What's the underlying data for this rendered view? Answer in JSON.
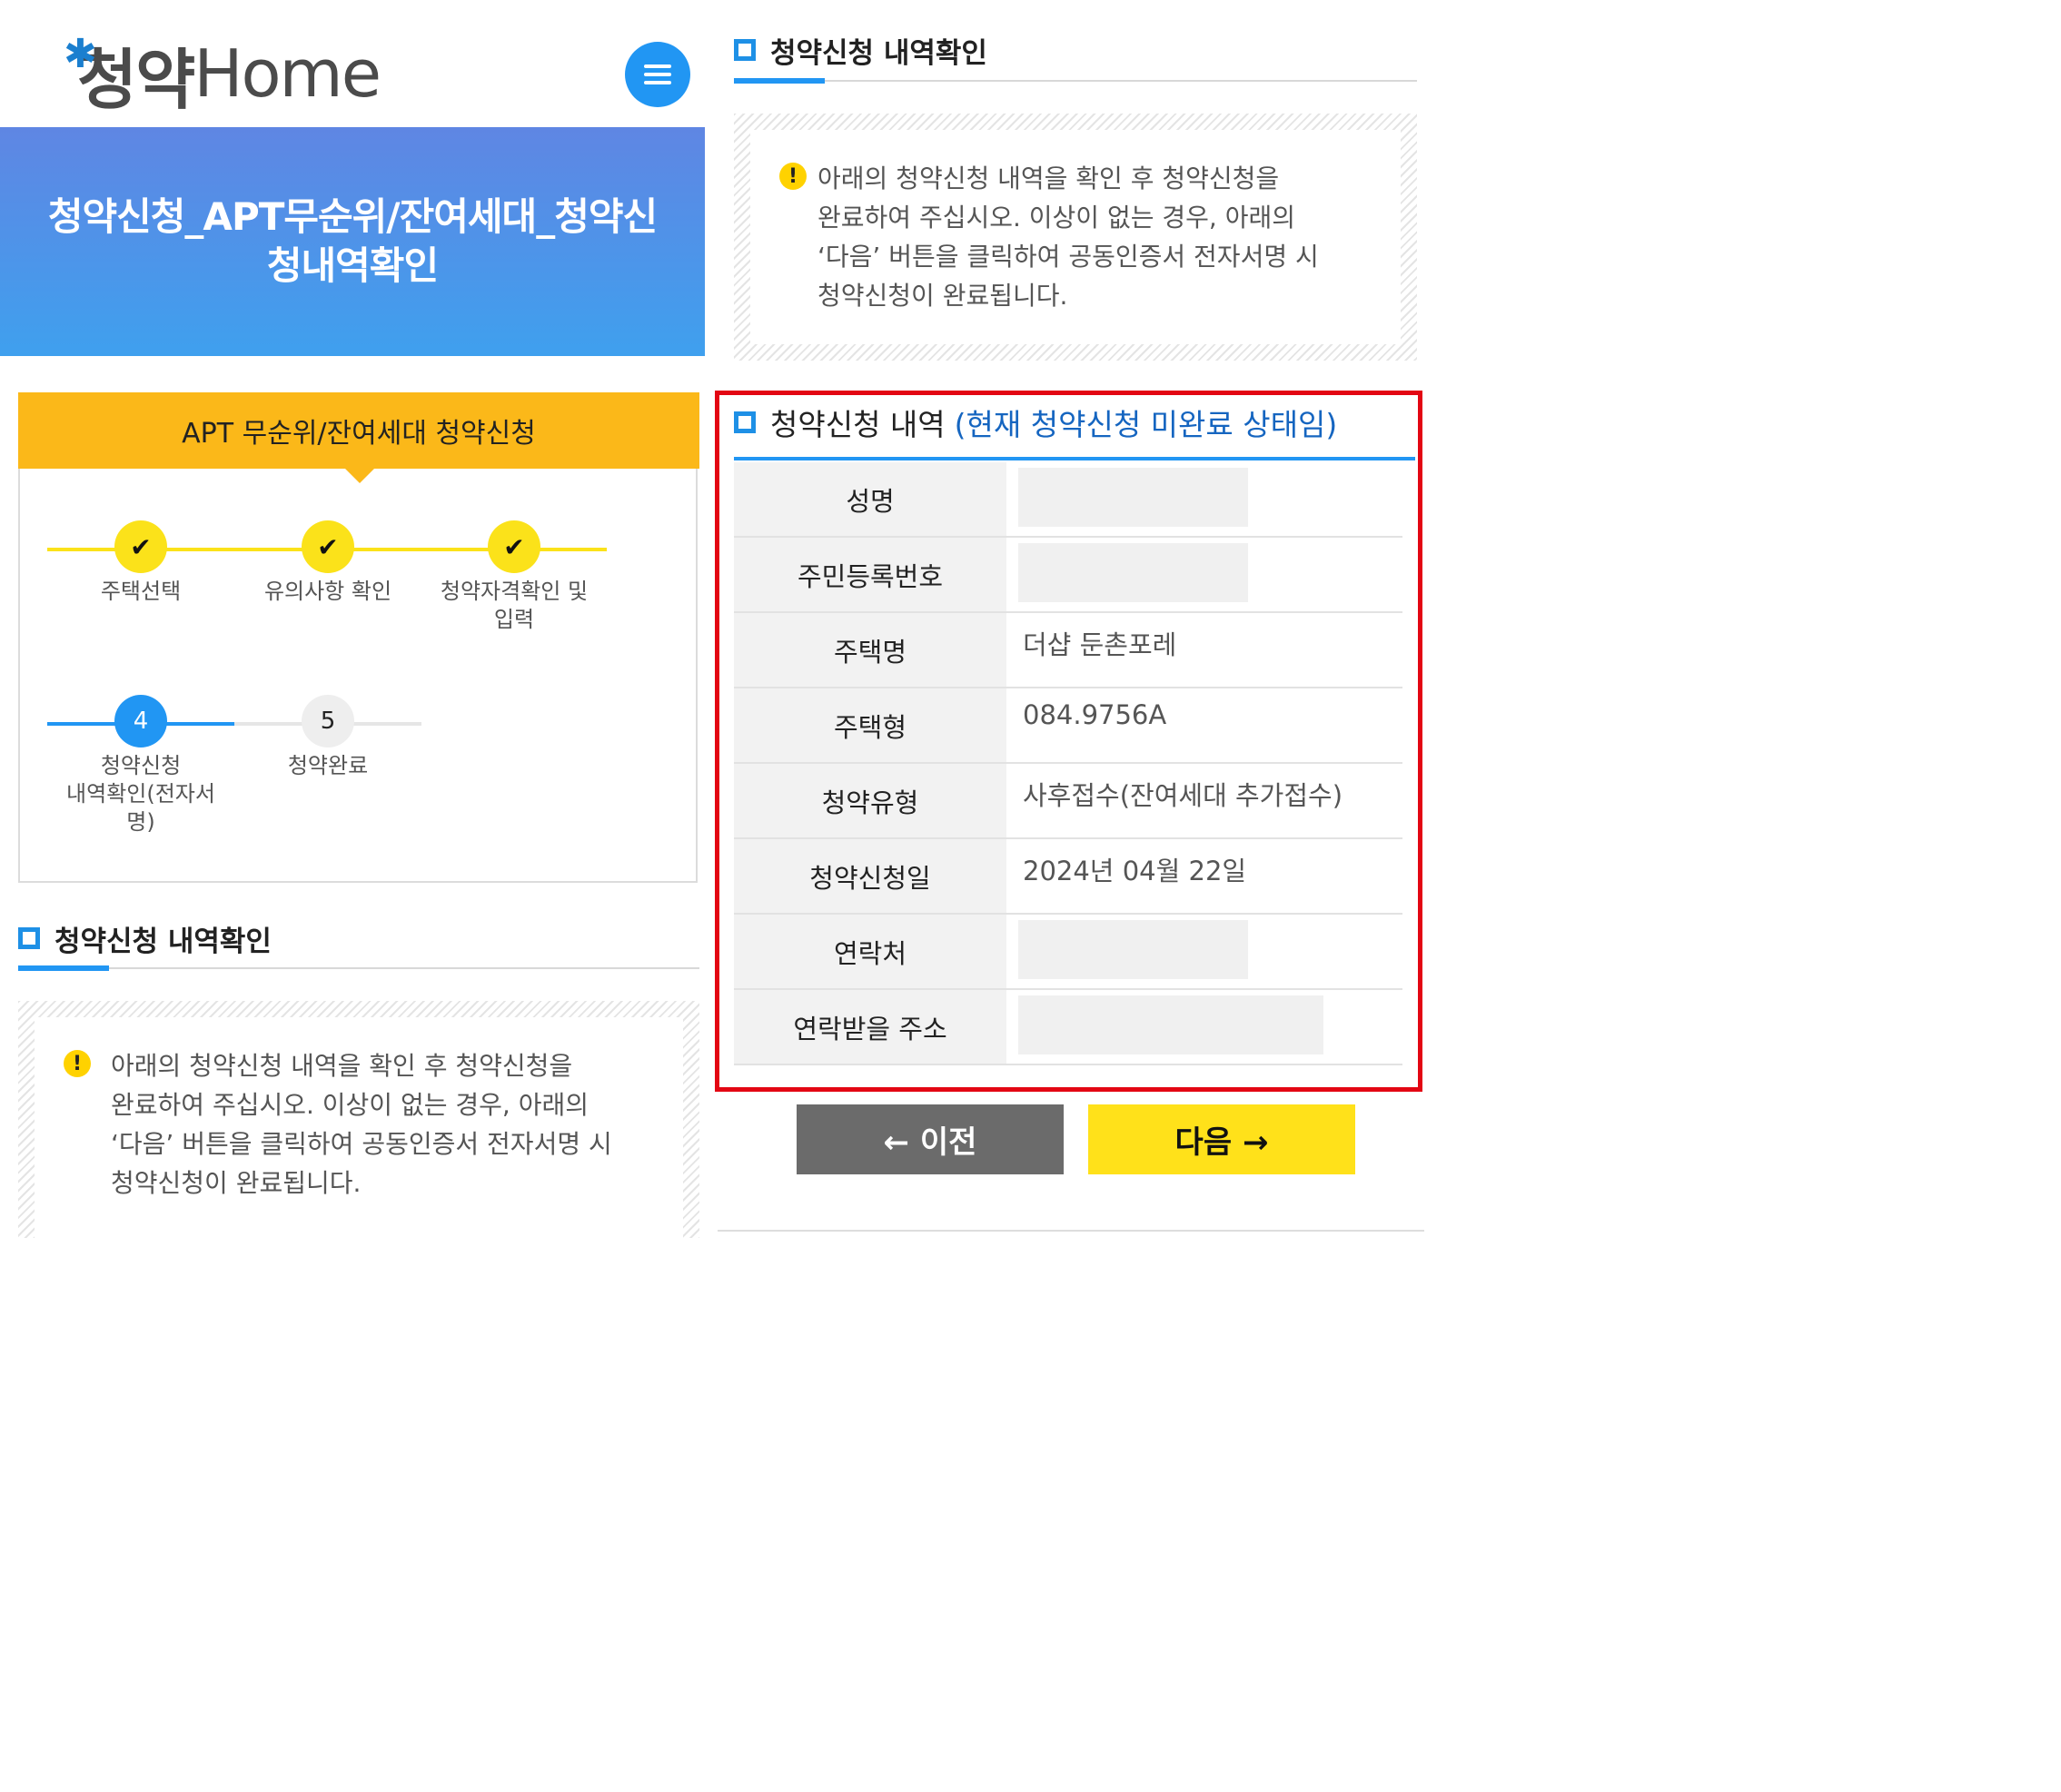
{
  "logo": {
    "brand_ko": "청약",
    "brand_en": "Home"
  },
  "hero": {
    "title_line1": "청약신청_APT무순위/잔여세대_청약신",
    "title_line2": "청내역확인"
  },
  "steps": {
    "header": "APT 무순위/잔여세대 청약신청",
    "items": [
      {
        "state": "done",
        "marker": "✔",
        "label": "주택선택"
      },
      {
        "state": "done",
        "marker": "✔",
        "label": "유의사항 확인"
      },
      {
        "state": "done",
        "marker": "✔",
        "label_line1": "청약자격확인 및",
        "label_line2": "입력"
      },
      {
        "state": "active",
        "marker": "4",
        "label_line1": "청약신청",
        "label_line2": "내역확인(전자서",
        "label_line3": "명)"
      },
      {
        "state": "todo",
        "marker": "5",
        "label": "청약완료"
      }
    ]
  },
  "section": {
    "title": "청약신청 내역확인"
  },
  "notice": {
    "icon": "!",
    "line1": "아래의 청약신청 내역을 확인 후 청약신청을",
    "line2": "완료하여 주십시오. 이상이 없는 경우, 아래의",
    "line3": "‘다음’ 버튼을 클릭하여 공동인증서 전자서명 시",
    "line4": "청약신청이 완료됩니다."
  },
  "history": {
    "title": "청약신청 내역",
    "status": "(현재 청약신청 미완료 상태임)",
    "rows": [
      {
        "label": "성명",
        "value": "",
        "masked": true
      },
      {
        "label": "주민등록번호",
        "value": "",
        "masked": true
      },
      {
        "label": "주택명",
        "value": "더샵 둔촌포레"
      },
      {
        "label": "주택형",
        "value": "084.9756A"
      },
      {
        "label": "청약유형",
        "value": "사후접수(잔여세대 추가접수)"
      },
      {
        "label": "청약신청일",
        "value": "2024년 04월 22일"
      },
      {
        "label": "연락처",
        "value": "",
        "masked": true
      },
      {
        "label": "연락받을 주소",
        "value": "",
        "masked": true
      }
    ]
  },
  "buttons": {
    "prev": "← 이전",
    "next": "다음 →"
  },
  "colors": {
    "accent_blue": "#2196f3",
    "step_yellow": "#fbe21a",
    "header_orange": "#fbb819",
    "highlight_red": "#e30613",
    "next_yellow": "#ffe11a",
    "prev_gray": "#6b6b6b"
  }
}
